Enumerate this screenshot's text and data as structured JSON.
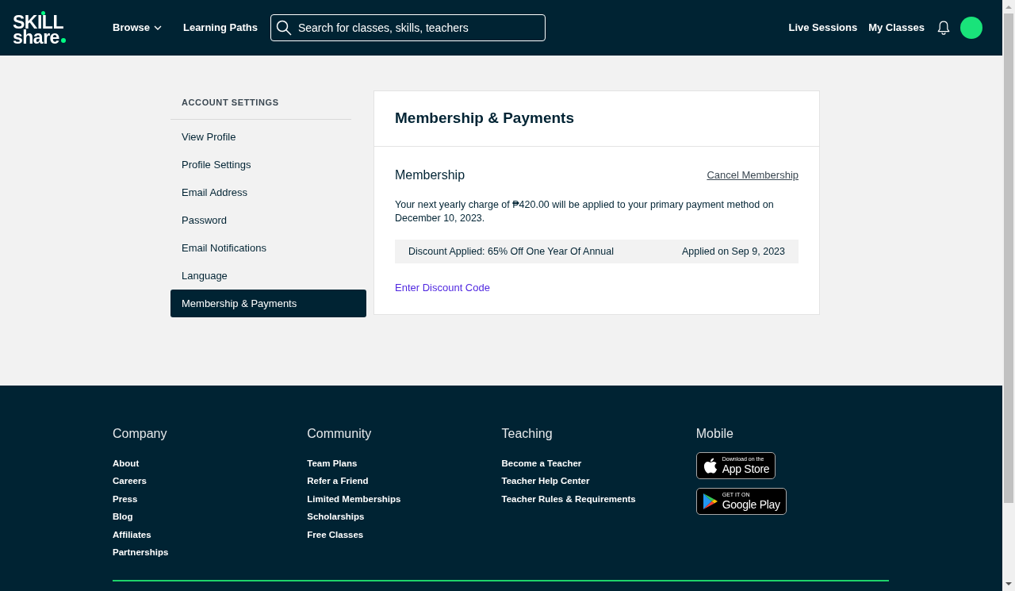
{
  "header": {
    "logo": {
      "line_1": "SKILL",
      "line_2": "share"
    },
    "nav": [
      {
        "label": "Browse",
        "kind": "dropdown"
      },
      {
        "label": "Learning Paths",
        "kind": "link"
      }
    ],
    "search": {
      "placeholder": "Search for classes, skills, teachers"
    },
    "right_nav": [
      "Live Sessions",
      "My Classes"
    ]
  },
  "sidebar": {
    "heading": "ACCOUNT SETTINGS",
    "items": [
      {
        "label": "View Profile",
        "selected": false
      },
      {
        "label": "Profile Settings",
        "selected": false
      },
      {
        "label": "Email Address",
        "selected": false
      },
      {
        "label": "Password",
        "selected": false
      },
      {
        "label": "Email Notifications",
        "selected": false
      },
      {
        "label": "Language",
        "selected": false
      },
      {
        "label": "Membership & Payments",
        "selected": true
      }
    ]
  },
  "card": {
    "title": "Membership & Payments",
    "section_title": "Membership",
    "cancel_link": "Cancel Membership",
    "message": "Your next yearly charge of ₱420.00 will be applied to your primary payment method on December 10, 2023.",
    "discount": {
      "label": "Discount Applied: 65% Off One Year Of Annual",
      "date": "Applied on Sep 9, 2023"
    },
    "discount_link": "Enter Discount Code"
  },
  "footer": {
    "columns": [
      {
        "heading": "Company",
        "kind": "links",
        "links": [
          "About",
          "Careers",
          "Press",
          "Blog",
          "Affiliates",
          "Partnerships"
        ]
      },
      {
        "heading": "Community",
        "kind": "links",
        "links": [
          "Team Plans",
          "Refer a Friend",
          "Limited Memberships",
          "Scholarships",
          "Free Classes"
        ]
      },
      {
        "heading": "Teaching",
        "kind": "links",
        "links": [
          "Become a Teacher",
          "Teacher Help Center",
          "Teacher Rules & Requirements"
        ]
      },
      {
        "heading": "Mobile",
        "kind": "badges",
        "badges": [
          {
            "kind": "apple",
            "small": "Download on the",
            "big": "App Store"
          },
          {
            "kind": "google",
            "small": "GET IT ON",
            "big": "Google Play"
          }
        ]
      }
    ]
  }
}
